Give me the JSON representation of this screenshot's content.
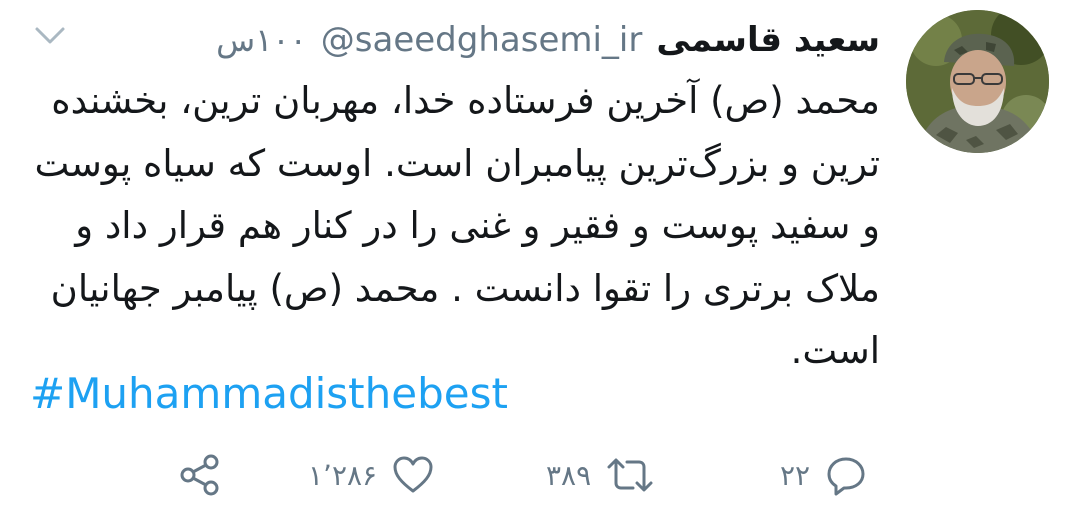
{
  "tweet": {
    "display_name": "سعید قاسمی",
    "username": "@saeedghasemi_ir",
    "timestamp": "۱۰۰س",
    "text": "محمد (ص) آخرین فرستاده خدا، مهربان ترین، بخشنده ترین و بزرگ‌ترین پیامبران است. اوست که سیاه پوست و سفید پوست و فقیر و غنی را در کنار هم قرار داد و ملاک برتری  را تقوا دانست . محمد (ص) پیامبر جهانیان است.",
    "hashtag": "#Muhammadisthebest"
  },
  "actions": {
    "reply_count": "۲۲",
    "retweet_count": "۳۸۹",
    "like_count": "۱٬۲۸۶"
  },
  "icons": {
    "reply": "reply-icon",
    "retweet": "retweet-icon",
    "like": "heart-icon",
    "share": "share-icon",
    "menu": "chevron-down-icon"
  },
  "colors": {
    "text": "#14171a",
    "secondary": "#657786",
    "link": "#1da1f2",
    "background": "#ffffff"
  }
}
